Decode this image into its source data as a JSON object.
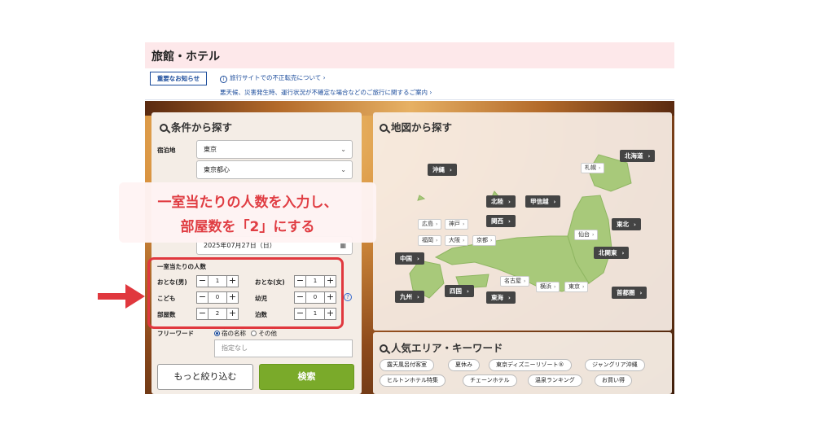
{
  "header": {
    "title": "旅館・ホテル"
  },
  "notices": {
    "button": "重要なお知らせ",
    "line1": "旅行サイトでの不正転売について",
    "line2": "悪天候、災害発生時、運行状況が不確定な場合などのご旅行に関するご案内"
  },
  "search_panel": {
    "title": "条件から探す",
    "stay_label": "宿泊地",
    "prefecture": "東京",
    "area": "東京都心",
    "date": "2025年07月27日（日）",
    "per_room_label": "一室当たりの人数",
    "adult_male_label": "おとな(男)",
    "adult_male_value": "1",
    "adult_female_label": "おとな(女)",
    "adult_female_value": "1",
    "child_label": "こども",
    "child_value": "0",
    "infant_label": "幼児",
    "infant_value": "0",
    "rooms_label": "部屋数",
    "rooms_value": "2",
    "nights_label": "泊数",
    "nights_value": "1",
    "freeword_label": "フリーワード",
    "radio_name": "宿の名称",
    "radio_other": "その他",
    "freeword_placeholder": "指定なし",
    "more_button": "もっと絞り込む",
    "search_button": "検索",
    "help_icon": "?"
  },
  "map_panel": {
    "title": "地図から探す",
    "regions": {
      "okinawa": "沖縄",
      "hokkaido": "北海道",
      "hokuriku": "北陸",
      "koshinetsu": "甲信越",
      "kansai": "関西",
      "tohoku": "東北",
      "chugoku": "中国",
      "kitakanto": "北関東",
      "kyushu": "九州",
      "shikoku": "四国",
      "tokai": "東海",
      "shutoken": "首都圏"
    },
    "cities": {
      "sapporo": "札幌",
      "hiroshima": "広島",
      "kobe": "神戸",
      "fukuoka": "福岡",
      "osaka": "大阪",
      "kyoto": "京都",
      "sendai": "仙台",
      "nagoya": "名古屋",
      "yokohama": "横浜",
      "tokyo": "東京"
    }
  },
  "keyword_panel": {
    "title": "人気エリア・キーワード",
    "chips": [
      "露天風呂付客室",
      "夏休み",
      "東京ディズニーリゾート®",
      "ジャングリア沖縄",
      "ヒルトンホテル特集",
      "チェーンホテル",
      "温泉ランキング",
      "お買い得"
    ]
  },
  "annotation": {
    "line1": "一室当たりの人数を入力し、",
    "line2": "部屋数を「2」にする"
  },
  "colors": {
    "accent_red": "#e0383e",
    "search_green": "#7aaa2a",
    "link_blue": "#1a4b9b",
    "map_land": "#a8c97a"
  }
}
